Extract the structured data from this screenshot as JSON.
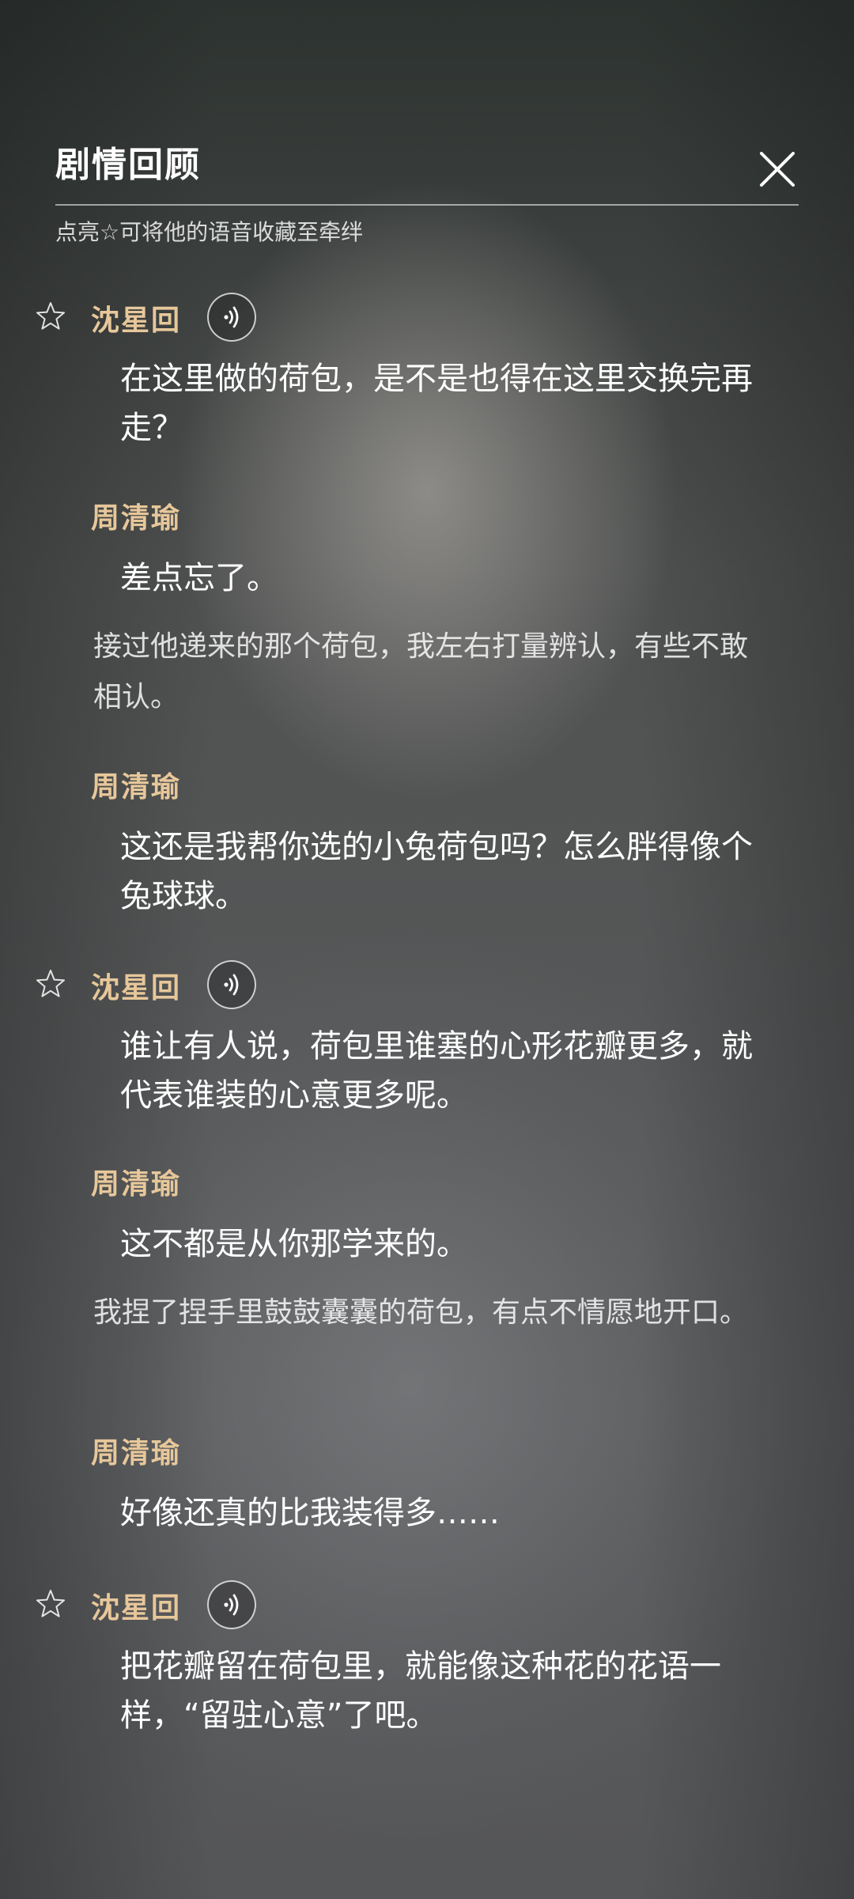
{
  "header": {
    "title": "剧情回顾",
    "hint": "点亮☆可将他的语音收藏至牵绊"
  },
  "entries": [
    {
      "speaker": "沈星回",
      "has_voice": true,
      "text": "在这里做的荷包，是不是也得在这里交换完再走？"
    },
    {
      "speaker": "周清瑜",
      "has_voice": false,
      "text": "差点忘了。"
    },
    {
      "narration": "接过他递来的那个荷包，我左右打量辨认，有些不敢相认。"
    },
    {
      "speaker": "周清瑜",
      "has_voice": false,
      "text": "这还是我帮你选的小兔荷包吗？怎么胖得像个兔球球。"
    },
    {
      "speaker": "沈星回",
      "has_voice": true,
      "text": "谁让有人说，荷包里谁塞的心形花瓣更多，就代表谁装的心意更多呢。"
    },
    {
      "speaker": "周清瑜",
      "has_voice": false,
      "text": "这不都是从你那学来的。"
    },
    {
      "narration": "我捏了捏手里鼓鼓囊囊的荷包，有点不情愿地开口。"
    },
    {
      "speaker": "周清瑜",
      "has_voice": false,
      "text": "好像还真的比我装得多……"
    },
    {
      "speaker": "沈星回",
      "has_voice": true,
      "text": "把花瓣留在荷包里，就能像这种花的花语一样，“留驻心意”了吧。"
    }
  ],
  "colors": {
    "speaker": "#e7c79a",
    "text": "#ffffff",
    "narration": "rgba(255,255,255,0.82)"
  },
  "icons": {
    "close": "close-icon",
    "star": "star-outline-icon",
    "voice": "sound-wave-icon"
  }
}
